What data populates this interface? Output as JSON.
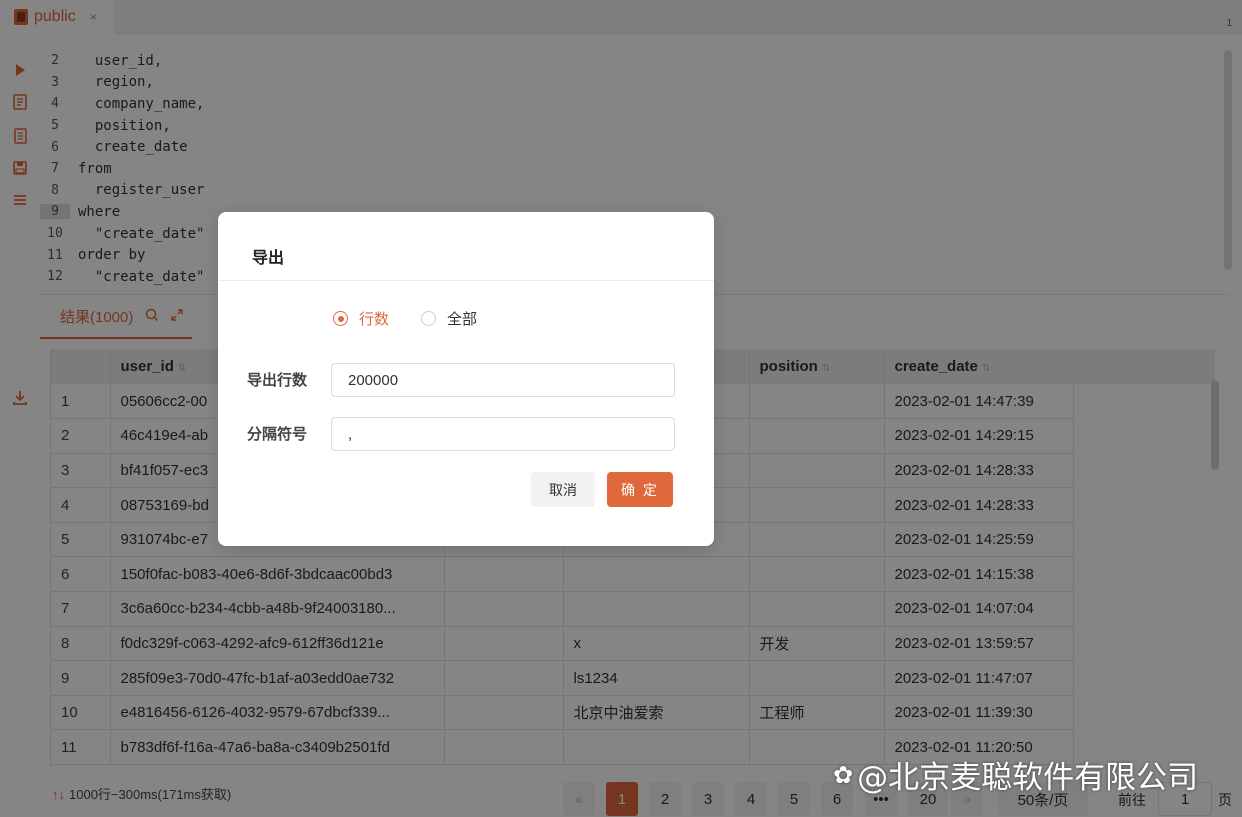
{
  "tabbar": {
    "tab_name": "public",
    "tab_close": "×",
    "tab_count": "1"
  },
  "editor": {
    "lines": [
      {
        "num": "2",
        "text": "  user_id,"
      },
      {
        "num": "3",
        "text": "  region,"
      },
      {
        "num": "4",
        "text": "  company_name,"
      },
      {
        "num": "5",
        "text": "  position,"
      },
      {
        "num": "6",
        "text": "  create_date"
      },
      {
        "num": "7",
        "text": "from"
      },
      {
        "num": "8",
        "text": "  register_user"
      },
      {
        "num": "9",
        "text": "where"
      },
      {
        "num": "10",
        "text": "  \"create_date\""
      },
      {
        "num": "11",
        "text": "order by"
      },
      {
        "num": "12",
        "text": "  \"create_date\""
      }
    ]
  },
  "results": {
    "tab_label": "结果(1000)"
  },
  "table": {
    "headers": [
      "",
      "user_id",
      "",
      "",
      "position",
      "create_date"
    ],
    "rows": [
      [
        "1",
        "05606cc2-00",
        "",
        "",
        "",
        "2023-02-01 14:47:39"
      ],
      [
        "2",
        "46c419e4-ab",
        "",
        "",
        "",
        "2023-02-01 14:29:15"
      ],
      [
        "3",
        "bf41f057-ec3",
        "",
        "",
        "",
        "2023-02-01 14:28:33"
      ],
      [
        "4",
        "08753169-bd",
        "",
        "",
        "",
        "2023-02-01 14:28:33"
      ],
      [
        "5",
        "931074bc-e7",
        "",
        "",
        "",
        "2023-02-01 14:25:59"
      ],
      [
        "6",
        "150f0fac-b083-40e6-8d6f-3bdcaac00bd3",
        "",
        "",
        "",
        "2023-02-01 14:15:38"
      ],
      [
        "7",
        "3c6a60cc-b234-4cbb-a48b-9f24003180...",
        "",
        "",
        "",
        "2023-02-01 14:07:04"
      ],
      [
        "8",
        "f0dc329f-c063-4292-afc9-612ff36d121e",
        "",
        "x",
        "开发",
        "2023-02-01 13:59:57"
      ],
      [
        "9",
        "285f09e3-70d0-47fc-b1af-a03edd0ae732",
        "",
        "ls1234",
        "",
        "2023-02-01 11:47:07"
      ],
      [
        "10",
        "e4816456-6126-4032-9579-67dbcf339...",
        "",
        "北京中油爱索",
        "工程师",
        "2023-02-01 11:39:30"
      ],
      [
        "11",
        "b783df6f-f16a-47a6-ba8a-c3409b2501fd",
        "",
        "",
        "",
        "2023-02-01 11:20:50"
      ]
    ]
  },
  "footer": {
    "row_info": "1000行−300ms(171ms获取)",
    "pages": [
      "«",
      "1",
      "2",
      "3",
      "4",
      "5",
      "6",
      "•••",
      "20",
      "»"
    ],
    "current_page": "1",
    "page_size": "50条/页",
    "goto_label": "前往",
    "goto_value": "1",
    "page_unit": "页"
  },
  "modal": {
    "title": "导出",
    "option_rows": "行数",
    "option_all": "全部",
    "selected_option": "行数",
    "rows_label": "导出行数",
    "rows_value": "200000",
    "sep_label": "分隔符号",
    "sep_value": ",",
    "cancel_label": "取消",
    "ok_label": "确 定"
  },
  "watermark": {
    "text": "@北京麦聪软件有限公司"
  },
  "colors": {
    "accent": "#e0693c",
    "overlay": "rgba(0,0,0,0.48)"
  },
  "icons": [
    "database-icon",
    "run-icon",
    "format-icon",
    "snippet-icon",
    "save-icon",
    "list-icon",
    "download-icon",
    "search-icon",
    "expand-icon",
    "sort-icon"
  ]
}
